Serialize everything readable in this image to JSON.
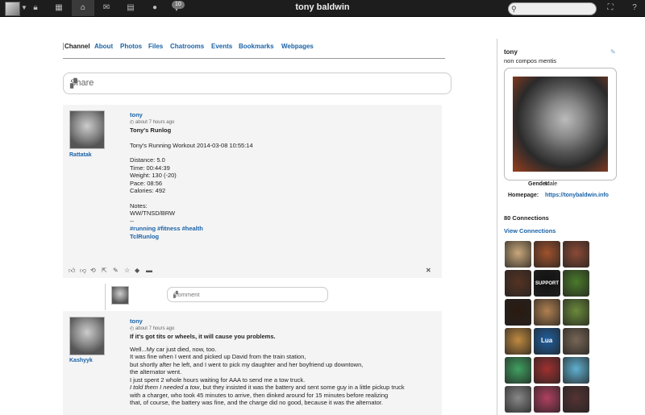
{
  "topbar": {
    "title": "tony baldwin",
    "notif_count": "10",
    "search_placeholder": "",
    "icons": [
      "avatar",
      "caret-down-icon",
      "lock-icon",
      "grid-icon",
      "home-icon",
      "mail-icon",
      "calendar-icon",
      "user-icon",
      "chat-icon",
      "search-icon",
      "sitemap-icon",
      "help-icon"
    ]
  },
  "tabs": [
    "Channel",
    "About",
    "Photos",
    "Files",
    "Chatrooms",
    "Events",
    "Bookmarks",
    "Webpages"
  ],
  "share_label": "Share",
  "post1": {
    "site": "Rattatak",
    "author": "tony",
    "time": "about 7 hours ago",
    "title": "Tony's Runlog",
    "lines": [
      "Tony's Running Workout 2014-03-08 10:55:14",
      "",
      "Distance: 5.0",
      "Time: 00:44:39",
      "Weight: 130 (-20)",
      "Pace: 08:56",
      "Calories: 492",
      "",
      "Notes:",
      "WW/TNSD/BRW",
      "--"
    ],
    "tags": "#running #fitness #health",
    "footer_link": "TclRunlog"
  },
  "comment_placeholder": "Comment",
  "post2": {
    "site": "Kashyyk",
    "author": "tony",
    "time": "about 7 hours ago",
    "title": "If it's got tits or wheels, it will cause you problems.",
    "lines": [
      "Well...My car just died, now, too.",
      "It was fine when I went and picked up David from the train station,",
      "but shortly after he left, and I went to pick my daughter and her boyfriend up downtown,",
      "the alternator went.",
      "I just spent 2 whole hours waiting for AAA to send me a tow truck."
    ],
    "italic": "I told them I needed a tow",
    "lines_after": [
      ", but they insisted it was the battery and sent some guy in a little pickup truck",
      "with a charger, who took 45 minutes to arrive, then dinked around for 15 minutes before realizing",
      "that, of course, the battery was fine, and the charge did no good, because it was the alternator."
    ]
  },
  "profile": {
    "name": "tony",
    "tagline": "non compos mentis",
    "gender_label": "Gender:",
    "gender": "Male",
    "homepage_label": "Homepage:",
    "homepage": "https://tonybaldwin.info",
    "connections": "80 Connections",
    "view_connections": "View Connections",
    "support_label": "SUPPORT",
    "lua_label": "Lua"
  },
  "thumb_colors": [
    "#c9a87a",
    "#a0522d",
    "#8b4a35",
    "#553322",
    "#111111",
    "#4a7a2a",
    "#2b1a10",
    "#b08050",
    "#6a8a3a",
    "#c08a40",
    "#2060a0",
    "#776655",
    "#40a060",
    "#a03030",
    "#60b0d0",
    "#888888",
    "#b04060",
    "#553333"
  ]
}
